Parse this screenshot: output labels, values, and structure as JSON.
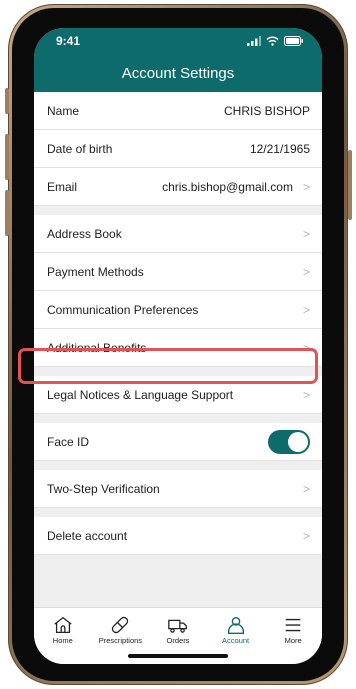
{
  "status_bar": {
    "time": "9:41"
  },
  "header": {
    "title": "Account Settings"
  },
  "profile": {
    "name_label": "Name",
    "name_value": "CHRIS BISHOP",
    "dob_label": "Date of birth",
    "dob_value": "12/21/1965",
    "email_label": "Email",
    "email_value": "chris.bishop@gmail.com"
  },
  "menu": {
    "address_book": "Address Book",
    "payment_methods": "Payment Methods",
    "communication_preferences": "Communication Preferences",
    "additional_benefits": "Additional Benefits",
    "legal_notices": "Legal Notices & Language Support",
    "face_id": "Face ID",
    "face_id_enabled": true,
    "two_step": "Two-Step Verification",
    "delete_account": "Delete account"
  },
  "tabs": [
    {
      "label": "Home",
      "icon": "home-icon"
    },
    {
      "label": "Prescriptions",
      "icon": "pill-icon"
    },
    {
      "label": "Orders",
      "icon": "truck-icon"
    },
    {
      "label": "Account",
      "icon": "person-icon",
      "active": true
    },
    {
      "label": "More",
      "icon": "menu-icon"
    }
  ],
  "colors": {
    "brand": "#0e6b6b",
    "highlight": "#e15357"
  }
}
